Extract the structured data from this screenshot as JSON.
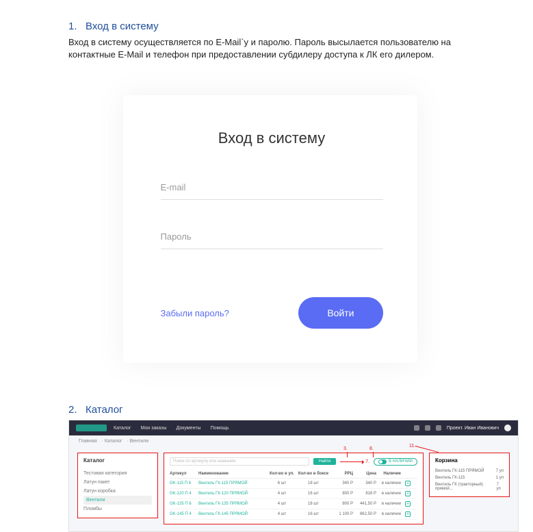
{
  "section1": {
    "number": "1.",
    "title": "Вход в систему",
    "body": "Вход в систему осуществляется по E-Mail`у и паролю. Пароль высылается пользователю на контактные E-Mail и телефон при предоставлении субдилеру доступа к ЛК его дилером."
  },
  "login": {
    "title": "Вход в систему",
    "email_placeholder": "E-mail",
    "password_placeholder": "Пароль",
    "forgot": "Забыли пароль?",
    "submit": "Войти"
  },
  "section2": {
    "number": "2.",
    "title": "Каталог"
  },
  "catalog": {
    "nav": {
      "items": [
        "Каталог",
        "Мои заказы",
        "Документы",
        "Помощь"
      ],
      "user": "Проект. Иван Иванович"
    },
    "breadcrumbs": [
      "Главная",
      "Каталог",
      "Вентили"
    ],
    "sidebar": {
      "title": "Каталог",
      "items": [
        "Тестовая категория",
        "Латун пакет",
        "Латун коробка",
        "Вентили",
        "Пломбы"
      ]
    },
    "search_placeholder": "Поиск по артикулу или названию",
    "find_btn": "Найти",
    "instock_label": "В НАЛИЧИИ",
    "annotations": {
      "a3": "3.",
      "a7": "7.",
      "a8": "8.",
      "a11": "11."
    },
    "columns": {
      "art": "Артикул",
      "name": "Наименование",
      "pk": "Кол-во в уп.",
      "box": "Кол-во в боксе",
      "rrc": "РРЦ",
      "price": "Цена",
      "stock": "Наличие"
    },
    "rows": [
      {
        "art": "GK-115 П 6",
        "name": "Вентиль ГК-115 ПРЯМОЙ",
        "pk": "6 шт",
        "box": "18 шт",
        "rrc": "340 Р",
        "price": "340 Р",
        "stock": "в наличии"
      },
      {
        "art": "GK-120 П 4",
        "name": "Вентиль ГК-120 ПРЯМОЙ",
        "pk": "4 шт",
        "box": "16 шт",
        "rrc": "800 Р",
        "price": "816 Р",
        "stock": "в наличии"
      },
      {
        "art": "GK-135 П 6",
        "name": "Вентиль ГК-135 ПРЯМОЙ",
        "pk": "4 шт",
        "box": "18 шт",
        "rrc": "800 Р",
        "price": "441,50 Р",
        "stock": "в наличии"
      },
      {
        "art": "GK-145 П 4",
        "name": "Вентиль ГК-145 ПРЯМОЙ",
        "pk": "4 шт",
        "box": "16 шт",
        "rrc": "1 100 Р",
        "price": "862,50 Р",
        "stock": "в наличии"
      }
    ],
    "cart": {
      "title": "Корзина",
      "rows": [
        {
          "name": "Вентиль ГК-115 ПРЯМОЙ",
          "qty": "7 уп"
        },
        {
          "name": "Вентиль ГК-115",
          "qty": "1 уп"
        },
        {
          "name": "Вентиль ГК (тракторный) прямой...",
          "qty": "7 уп"
        }
      ]
    }
  }
}
